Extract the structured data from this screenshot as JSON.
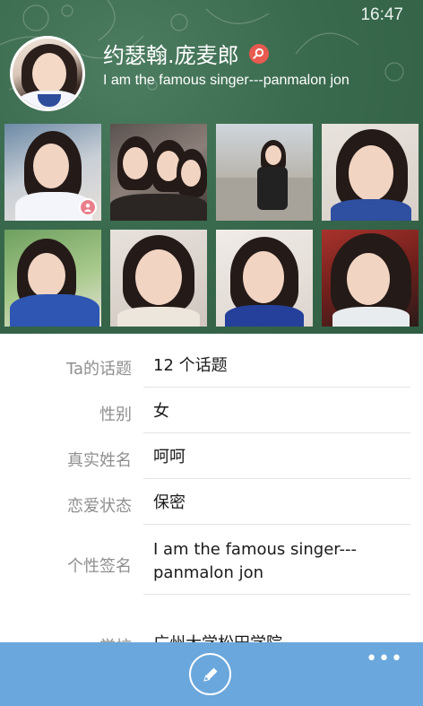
{
  "status_bar": {
    "time": "16:47"
  },
  "profile": {
    "name": "约瑟翰.庞麦郎",
    "tagline": "I am the famous singer---panmalon jon"
  },
  "photos": [
    {
      "label": "photo-1"
    },
    {
      "label": "photo-2"
    },
    {
      "label": "photo-3"
    },
    {
      "label": "photo-4"
    },
    {
      "label": "photo-5"
    },
    {
      "label": "photo-6"
    },
    {
      "label": "photo-7"
    },
    {
      "label": "photo-8"
    }
  ],
  "info": {
    "topics": {
      "label": "Ta的话题",
      "value": "12 个话题"
    },
    "gender": {
      "label": "性别",
      "value": "女"
    },
    "real_name": {
      "label": "真实姓名",
      "value": "呵呵"
    },
    "relationship": {
      "label": "恋爱状态",
      "value": "保密"
    },
    "signature": {
      "label": "个性签名",
      "value": "I am the famous singer---panmalon jon"
    },
    "school": {
      "label": "学校",
      "value": "广州大学松田学院"
    }
  },
  "app_bar": {
    "more_label": "•••"
  },
  "icons": {
    "verify": "search-badge-icon",
    "edit": "pencil-icon",
    "person": "person-icon"
  },
  "colors": {
    "header_green": "#3a6a4e",
    "app_bar_blue": "#6aa7dc",
    "badge_red": "#e85a50"
  }
}
